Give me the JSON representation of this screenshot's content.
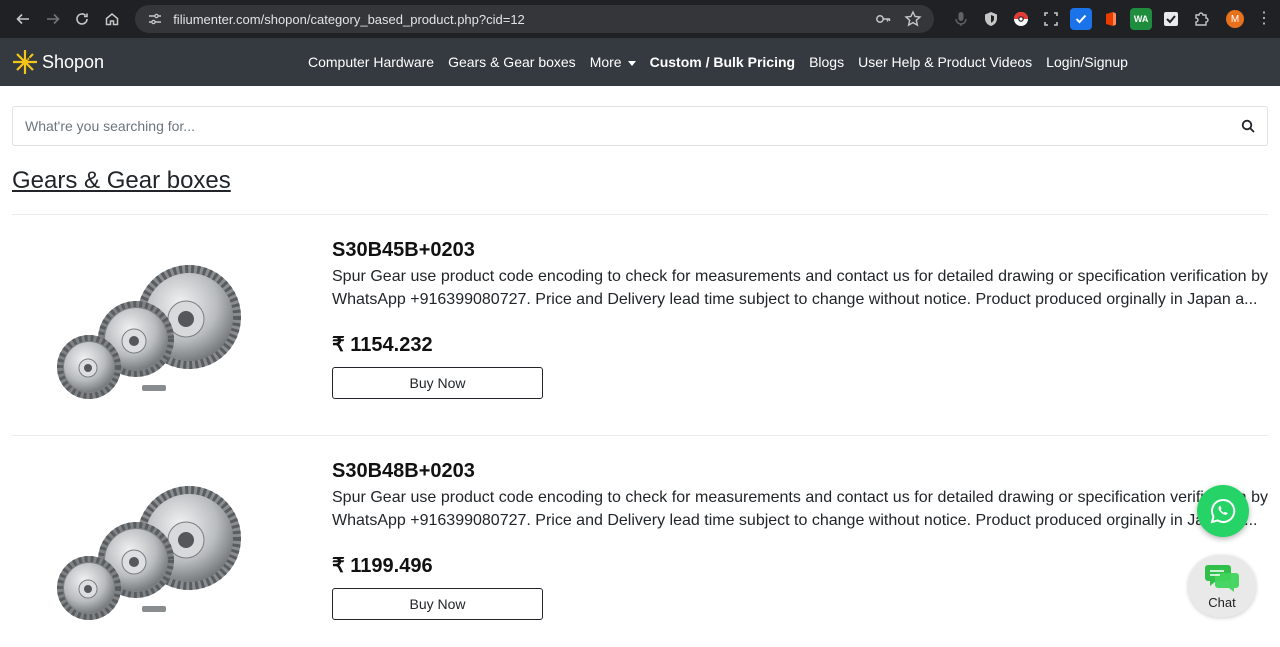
{
  "browser": {
    "url": "filiumenter.com/shopon/category_based_product.php?cid=12",
    "profile_initial": "M",
    "extensions": [
      {
        "name": "mic-icon",
        "color": "#202124",
        "text": ""
      },
      {
        "name": "shield-extension-icon",
        "color": "#202124",
        "text": ""
      },
      {
        "name": "pokeball-extension-icon",
        "color": "#202124",
        "text": ""
      },
      {
        "name": "screenshot-extension-icon",
        "color": "#202124",
        "text": ""
      },
      {
        "name": "checkbox-extension-icon",
        "color": "#1a73e8",
        "text": ""
      },
      {
        "name": "office-extension-icon",
        "color": "#202124",
        "text": ""
      },
      {
        "name": "whatsapp-web-extension-icon",
        "color": "#1e8e3e",
        "text": "WA"
      },
      {
        "name": "check-extension-icon",
        "color": "#202124",
        "text": ""
      },
      {
        "name": "puzzle-extensions-icon",
        "color": "#202124",
        "text": ""
      }
    ]
  },
  "navbar": {
    "brand": "Shopon",
    "links": [
      {
        "label": "Computer Hardware",
        "bold": false
      },
      {
        "label": "Gears & Gear boxes",
        "bold": false
      },
      {
        "label": "More",
        "bold": false,
        "dropdown": true
      },
      {
        "label": "Custom / Bulk Pricing",
        "bold": true
      },
      {
        "label": "Blogs",
        "bold": false
      },
      {
        "label": "User Help & Product Videos",
        "bold": false
      },
      {
        "label": "Login/Signup",
        "bold": false
      }
    ]
  },
  "search": {
    "placeholder": "What're you searching for..."
  },
  "category": {
    "title": "Gears & Gear boxes"
  },
  "products": [
    {
      "name": "S30B45B+0203",
      "description": "Spur Gear use product code encoding to check for measurements and contact us for detailed drawing or specification verification by WhatsApp +916399080727. Price and Delivery lead time subject to change without notice. Product produced orginally in Japan a...",
      "price": "₹ 1154.232",
      "button": "Buy Now"
    },
    {
      "name": "S30B48B+0203",
      "description": "Spur Gear use product code encoding to check for measurements and contact us for detailed drawing or specification verification by WhatsApp +916399080727. Price and Delivery lead time subject to change without notice. Product produced orginally in Japan a...",
      "price": "₹ 1199.496",
      "button": "Buy Now"
    }
  ],
  "chat": {
    "label": "Chat"
  }
}
